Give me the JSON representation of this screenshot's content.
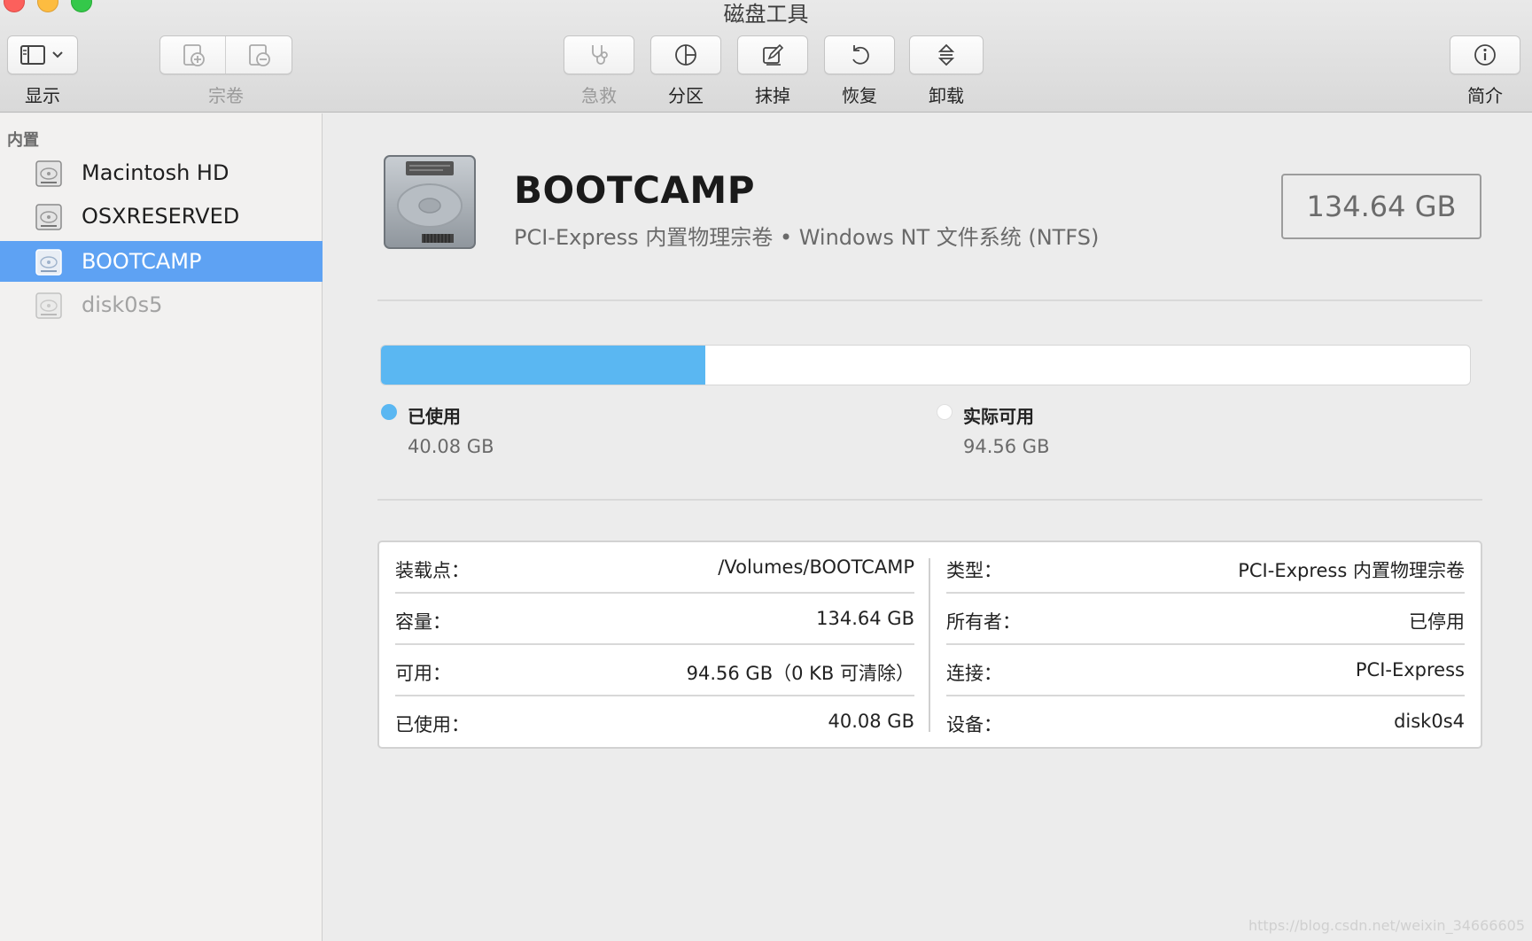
{
  "window": {
    "title": "磁盘工具"
  },
  "toolbar": {
    "show_label": "显示",
    "volume_label": "宗卷",
    "firstaid_label": "急救",
    "partition_label": "分区",
    "erase_label": "抹掉",
    "restore_label": "恢复",
    "unmount_label": "卸载",
    "info_label": "简介"
  },
  "sidebar": {
    "section": "内置",
    "items": [
      {
        "name": "Macintosh HD"
      },
      {
        "name": "OSXRESERVED"
      },
      {
        "name": "BOOTCAMP"
      },
      {
        "name": "disk0s5"
      }
    ],
    "selected_index": 2
  },
  "volume": {
    "name": "BOOTCAMP",
    "description": "PCI-Express 内置物理宗卷 • Windows NT 文件系统 (NTFS)",
    "size": "134.64 GB"
  },
  "usage": {
    "used_fraction": 0.298,
    "used_label": "已使用",
    "used_value": "40.08 GB",
    "free_label": "实际可用",
    "free_value": "94.56 GB",
    "used_color": "#5ab7f2",
    "free_color": "#ffffff"
  },
  "info": {
    "left": [
      {
        "key": "装载点：",
        "value": "/Volumes/BOOTCAMP"
      },
      {
        "key": "容量：",
        "value": "134.64 GB"
      },
      {
        "key": "可用：",
        "value": "94.56 GB（0 KB 可清除）"
      },
      {
        "key": "已使用：",
        "value": "40.08 GB"
      }
    ],
    "right": [
      {
        "key": "类型：",
        "value": "PCI-Express 内置物理宗卷"
      },
      {
        "key": "所有者：",
        "value": "已停用"
      },
      {
        "key": "连接：",
        "value": "PCI-Express"
      },
      {
        "key": "设备：",
        "value": "disk0s4"
      }
    ]
  },
  "watermark": "https://blog.csdn.net/weixin_34666605",
  "icons": {
    "sidebar_toggle": "sidebar-icon",
    "add_volume": "add-volume-icon",
    "remove_volume": "remove-volume-icon",
    "firstaid": "stethoscope-icon",
    "partition": "pie-icon",
    "erase": "erase-icon",
    "restore": "restore-icon",
    "unmount": "eject-icon",
    "info": "info-icon",
    "disk": "hard-disk-icon"
  }
}
